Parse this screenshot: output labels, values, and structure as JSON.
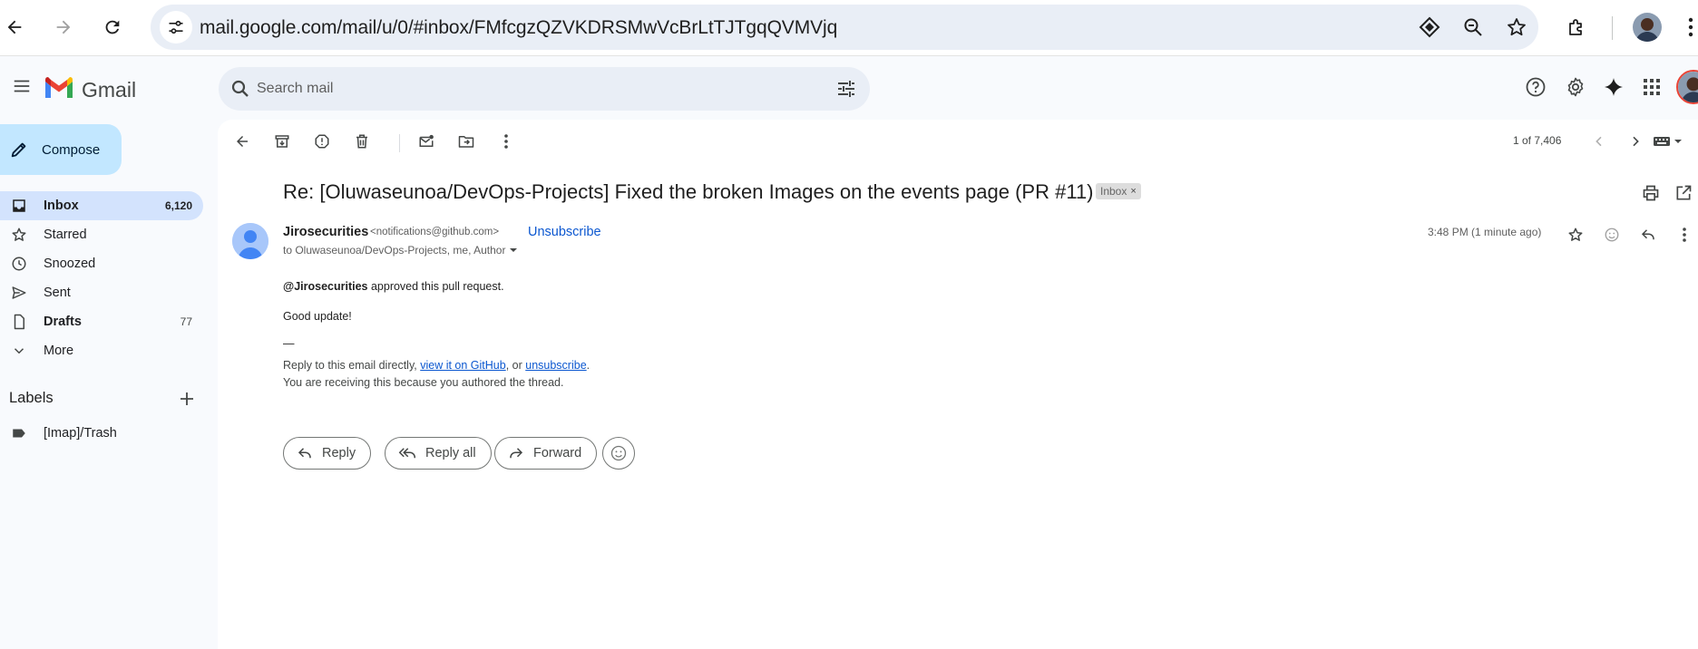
{
  "browser": {
    "url": "mail.google.com/mail/u/0/#inbox/FMfcgzQZVKDRSMwVcBrLtTJTgqQVMVjq"
  },
  "app": {
    "name": "Gmail"
  },
  "search": {
    "placeholder": "Search mail"
  },
  "sidebar": {
    "compose_label": "Compose",
    "items": [
      {
        "label": "Inbox",
        "count": "6,120",
        "icon": "inbox-icon",
        "active": true
      },
      {
        "label": "Starred",
        "count": "",
        "icon": "star-icon"
      },
      {
        "label": "Snoozed",
        "count": "",
        "icon": "clock-icon"
      },
      {
        "label": "Sent",
        "count": "",
        "icon": "send-icon"
      },
      {
        "label": "Drafts",
        "count": "77",
        "icon": "draft-icon"
      },
      {
        "label": "More",
        "count": "",
        "icon": "chevron-down-icon"
      }
    ],
    "labels_title": "Labels",
    "labels": [
      {
        "label": "[Imap]/Trash",
        "icon": "label-icon"
      }
    ]
  },
  "toolbar": {
    "page_count": "1 of 7,406"
  },
  "email": {
    "subject": "Re: [Oluwaseunoa/DevOps-Projects] Fixed the broken Images on the events page (PR #11)",
    "chip_label": "Inbox",
    "chip_close": "×",
    "sender_name": "Jirosecurities",
    "sender_email": "<notifications@github.com>",
    "unsubscribe": "Unsubscribe",
    "recipients": "to Oluwaseunoa/DevOps-Projects, me, Author",
    "timestamp": "3:48 PM (1 minute ago)",
    "body": {
      "mention": "@Jirosecurities",
      "approved_text": " approved this pull request.",
      "comment": "Good update!",
      "separator": "—",
      "footer_prefix": "Reply to this email directly, ",
      "footer_link1": "view it on GitHub",
      "footer_mid": ", or ",
      "footer_link2": "unsubscribe",
      "footer_suffix": ".",
      "footer_line2": "You are receiving this because you authored the thread."
    },
    "actions": {
      "reply": "Reply",
      "reply_all": "Reply all",
      "forward": "Forward"
    }
  },
  "colors": {
    "accent": "#0b57d0",
    "compose_bg": "#c2e7ff",
    "active_nav_bg": "#d3e3fd",
    "page_bg": "#f8fafd"
  }
}
